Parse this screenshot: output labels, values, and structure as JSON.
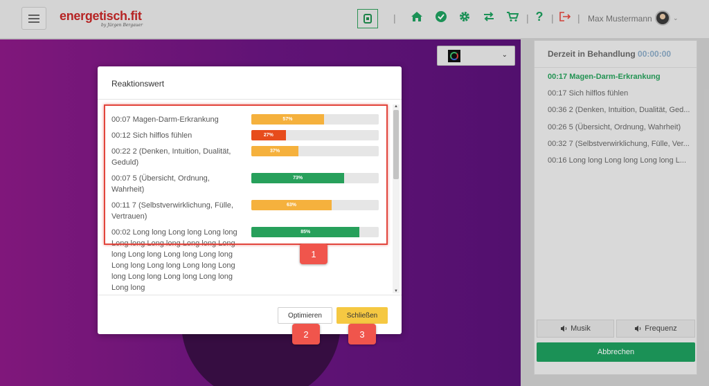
{
  "header": {
    "brand": "energetisch.fit",
    "brand_sub": "by Jürgen Bergauer",
    "user_name": "Max Mustermann",
    "help_label": "?"
  },
  "selector": {
    "chevron": "⌄"
  },
  "panel": {
    "title": "Derzeit in Behandlung",
    "timer": "00:00:00",
    "items": [
      "00:17 Magen-Darm-Erkrankung",
      "00:17 Sich hilflos fühlen",
      "00:36 2 (Denken, Intuition, Dualität, Ged...",
      "00:26 5 (Übersicht, Ordnung, Wahrheit)",
      "00:32 7 (Selbstverwirklichung, Fülle, Ver...",
      "00:16 Long long Long long Long long L..."
    ],
    "music_label": "Musik",
    "frequency_label": "Frequenz",
    "cancel_label": "Abbrechen"
  },
  "modal": {
    "title": "Reaktionswert",
    "rows": [
      {
        "label": "00:07 Magen-Darm-Erkrankung",
        "percent": 57,
        "percent_label": "57%",
        "color": "#f5b13d"
      },
      {
        "label": "00:12 Sich hilflos fühlen",
        "percent": 27,
        "percent_label": "27%",
        "color": "#e74c1c"
      },
      {
        "label": "00:22 2 (Denken, Intuition, Dualität, Geduld)",
        "percent": 37,
        "percent_label": "37%",
        "color": "#f5b13d"
      },
      {
        "label": "00:07 5 (Übersicht, Ordnung, Wahrheit)",
        "percent": 73,
        "percent_label": "73%",
        "color": "#27a05b"
      },
      {
        "label": "00:11 7 (Selbstverwirklichung, Fülle, Vertrauen)",
        "percent": 63,
        "percent_label": "63%",
        "color": "#f5b13d"
      },
      {
        "label": "00:02 Long long Long long Long long Long long Long long Long long Long long Long long Long long Long long Long long Long long Long long Long long Long long Long long Long long Long long",
        "percent": 85,
        "percent_label": "85%",
        "color": "#27a05b"
      }
    ],
    "optimize_label": "Optimieren",
    "close_label": "Schließen"
  },
  "badges": [
    "1",
    "2",
    "3"
  ],
  "colors": {
    "accent_green": "#27a05b",
    "brand_red": "#c62828",
    "highlight_red": "#e2453c",
    "close_yellow": "#f5c842"
  },
  "icons": [
    "menu-icon",
    "tablet-icon",
    "home-icon",
    "check-circle-icon",
    "gear-icon",
    "swap-icon",
    "cart-icon",
    "help-icon",
    "logout-icon",
    "avatar",
    "speaker-icon"
  ]
}
